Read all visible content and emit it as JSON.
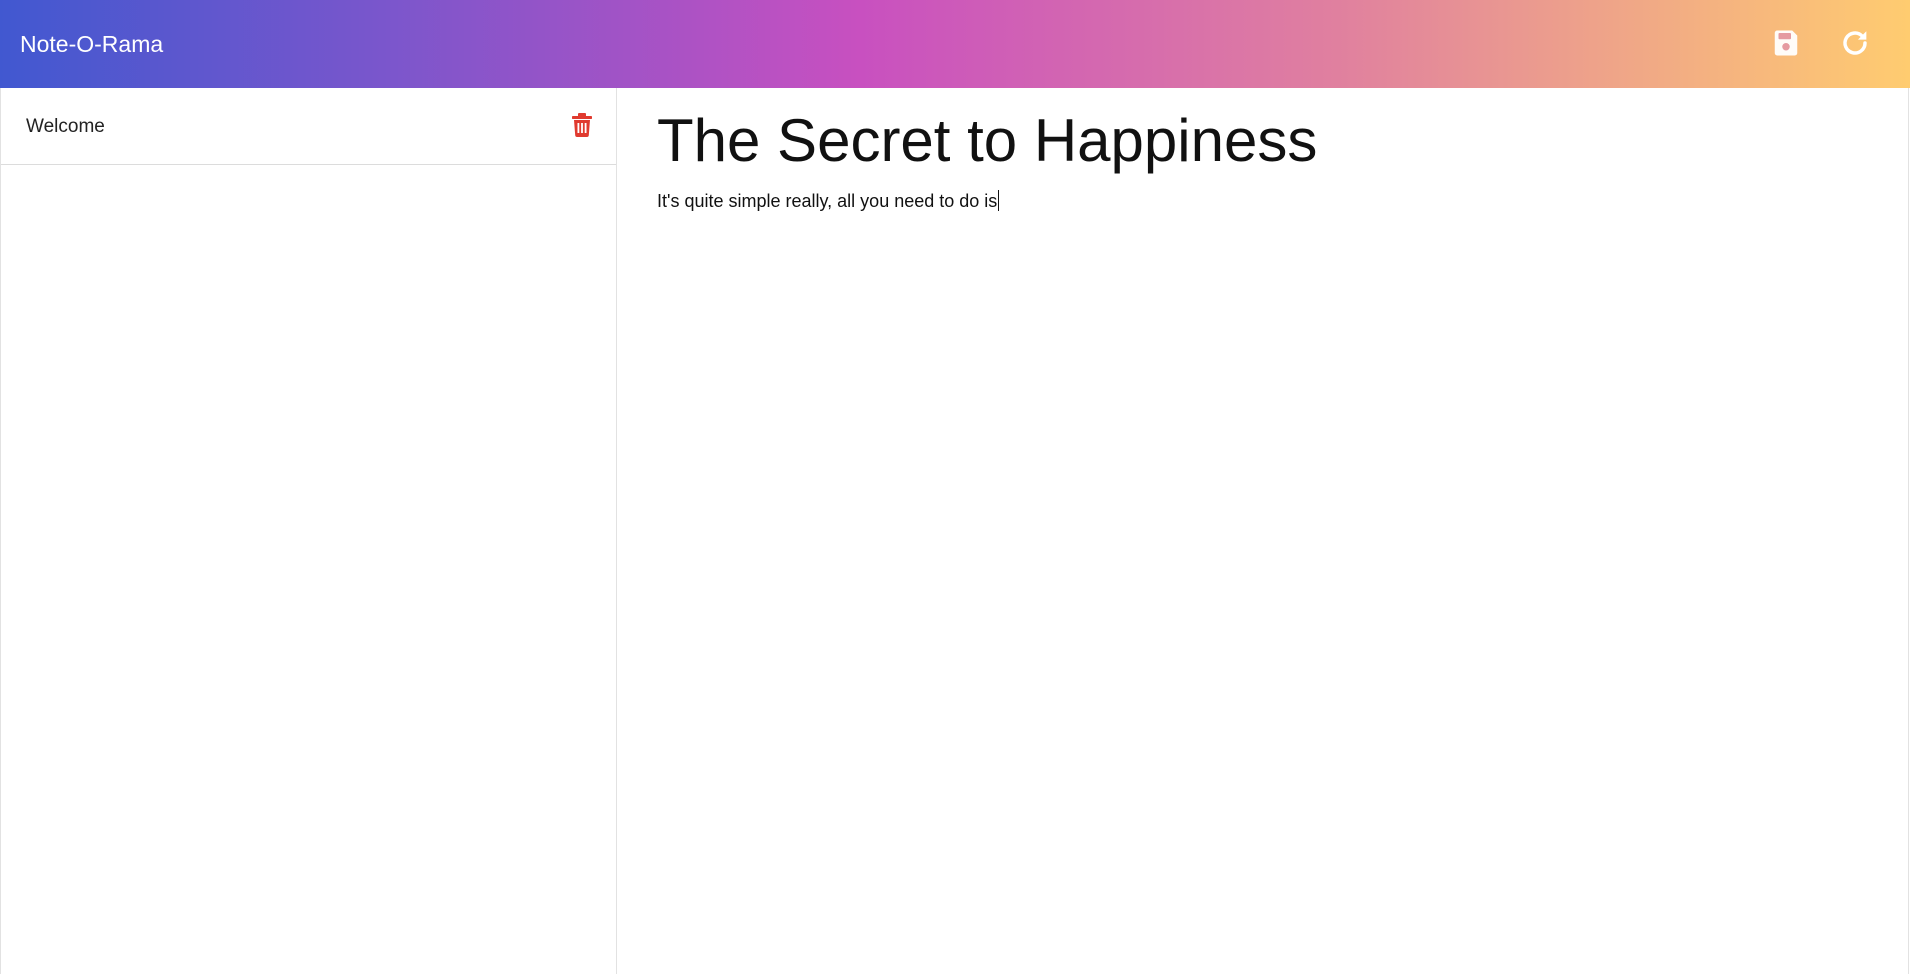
{
  "header": {
    "app_title": "Note-O-Rama",
    "save_icon": "save-icon",
    "reload_icon": "reload-icon"
  },
  "sidebar": {
    "notes": [
      {
        "label": "Welcome",
        "delete_icon": "trash-icon"
      }
    ]
  },
  "editor": {
    "title": "The Secret to Happiness",
    "body": "It's quite simple really, all you need to do is"
  },
  "colors": {
    "header_gradient": [
      "#4158d0",
      "#c850c0",
      "#ffcc70"
    ],
    "delete_icon": "#e03a2f",
    "header_icons": "#ffffff"
  }
}
